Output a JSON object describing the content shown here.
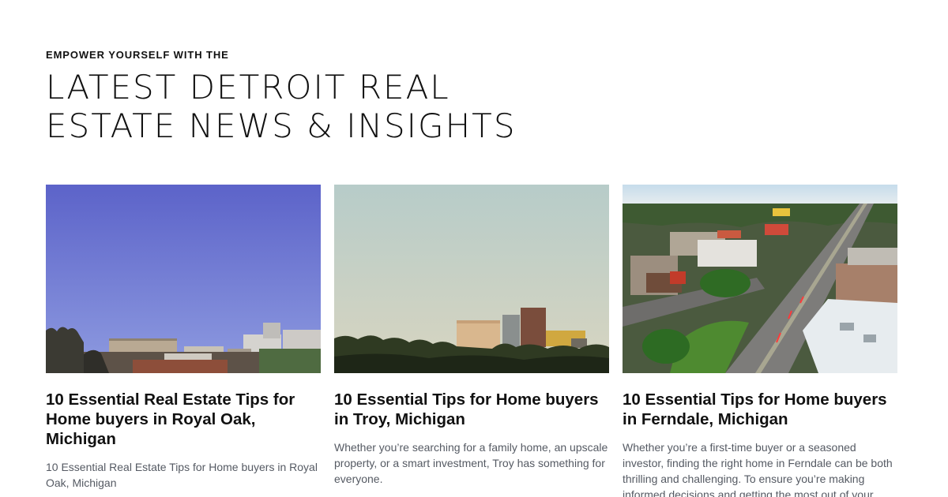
{
  "section": {
    "eyebrow": "EMPOWER YOURSELF WITH THE",
    "headline_line1": "LATEST DETROIT REAL",
    "headline_line2": "ESTATE NEWS & INSIGHTS"
  },
  "posts": [
    {
      "title": "10 Essential Real Estate Tips for Home buyers in Royal Oak, Michigan",
      "excerpt": "10 Essential Real Estate Tips for Home buyers in Royal Oak, Michigan",
      "image": "royal-oak-skyline-photo"
    },
    {
      "title": "10 Essential Tips for Home buyers in Troy, Michigan",
      "excerpt": "Whether you’re searching for a family home, an upscale property, or a smart investment, Troy has something for everyone.",
      "image": "troy-skyline-photo"
    },
    {
      "title": "10 Essential Tips for Home buyers in Ferndale, Michigan",
      "excerpt": "Whether you’re a first-time buyer or a seasoned investor, finding the right home in Ferndale can be both thrilling and challenging. To ensure you’re making informed decisions and getting the most out of your Ferndale real estate",
      "image": "ferndale-aerial-photo"
    }
  ]
}
